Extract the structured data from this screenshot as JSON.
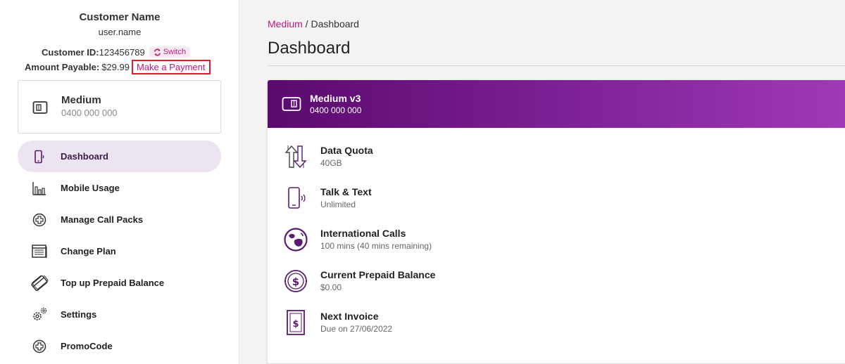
{
  "sidebar": {
    "customer_name": "Customer Name",
    "user_name": "user.name",
    "customer_id_label": "Customer ID:",
    "customer_id": "123456789",
    "switch_label": "Switch",
    "amount_label": "Amount Payable:",
    "amount_value": "$29.99",
    "pay_label": "Make a Payment",
    "plan": {
      "name": "Medium",
      "number": "0400 000 000",
      "icon": "sim-card-icon"
    },
    "nav": [
      {
        "label": "Dashboard",
        "icon": "mobile-phone-icon",
        "active": true
      },
      {
        "label": "Mobile Usage",
        "icon": "bar-chart-icon",
        "active": false
      },
      {
        "label": "Manage Call Packs",
        "icon": "plus-circle-icon",
        "active": false
      },
      {
        "label": "Change Plan",
        "icon": "calendar-icon",
        "active": false
      },
      {
        "label": "Top up Prepaid Balance",
        "icon": "card-icon",
        "active": false
      },
      {
        "label": "Settings",
        "icon": "gear-icon",
        "active": false
      },
      {
        "label": "PromoCode",
        "icon": "plus-circle-icon",
        "active": false
      }
    ]
  },
  "main": {
    "breadcrumb": {
      "link": "Medium",
      "separator": " / ",
      "current": "Dashboard"
    },
    "title": "Dashboard",
    "card": {
      "plan_name": "Medium v3",
      "plan_number": "0400 000 000",
      "features": [
        {
          "name": "Data Quota",
          "value": "40GB",
          "icon": "data-arrows-icon"
        },
        {
          "name": "Talk & Text",
          "value": "Unlimited",
          "icon": "mobile-phone-icon"
        },
        {
          "name": "International Calls",
          "value": "100 mins (40 mins remaining)",
          "icon": "globe-icon"
        },
        {
          "name": "Current Prepaid Balance",
          "value": "$0.00",
          "icon": "dollar-circle-icon"
        },
        {
          "name": "Next Invoice",
          "value": "Due on 27/06/2022",
          "icon": "invoice-icon"
        }
      ]
    }
  },
  "colors": {
    "accent": "#c2187a",
    "purple_dark": "#5a0a6e",
    "purple_light": "#a03ab8",
    "highlight_border": "#d8202c",
    "icon_purple": "#5a1a6e"
  }
}
